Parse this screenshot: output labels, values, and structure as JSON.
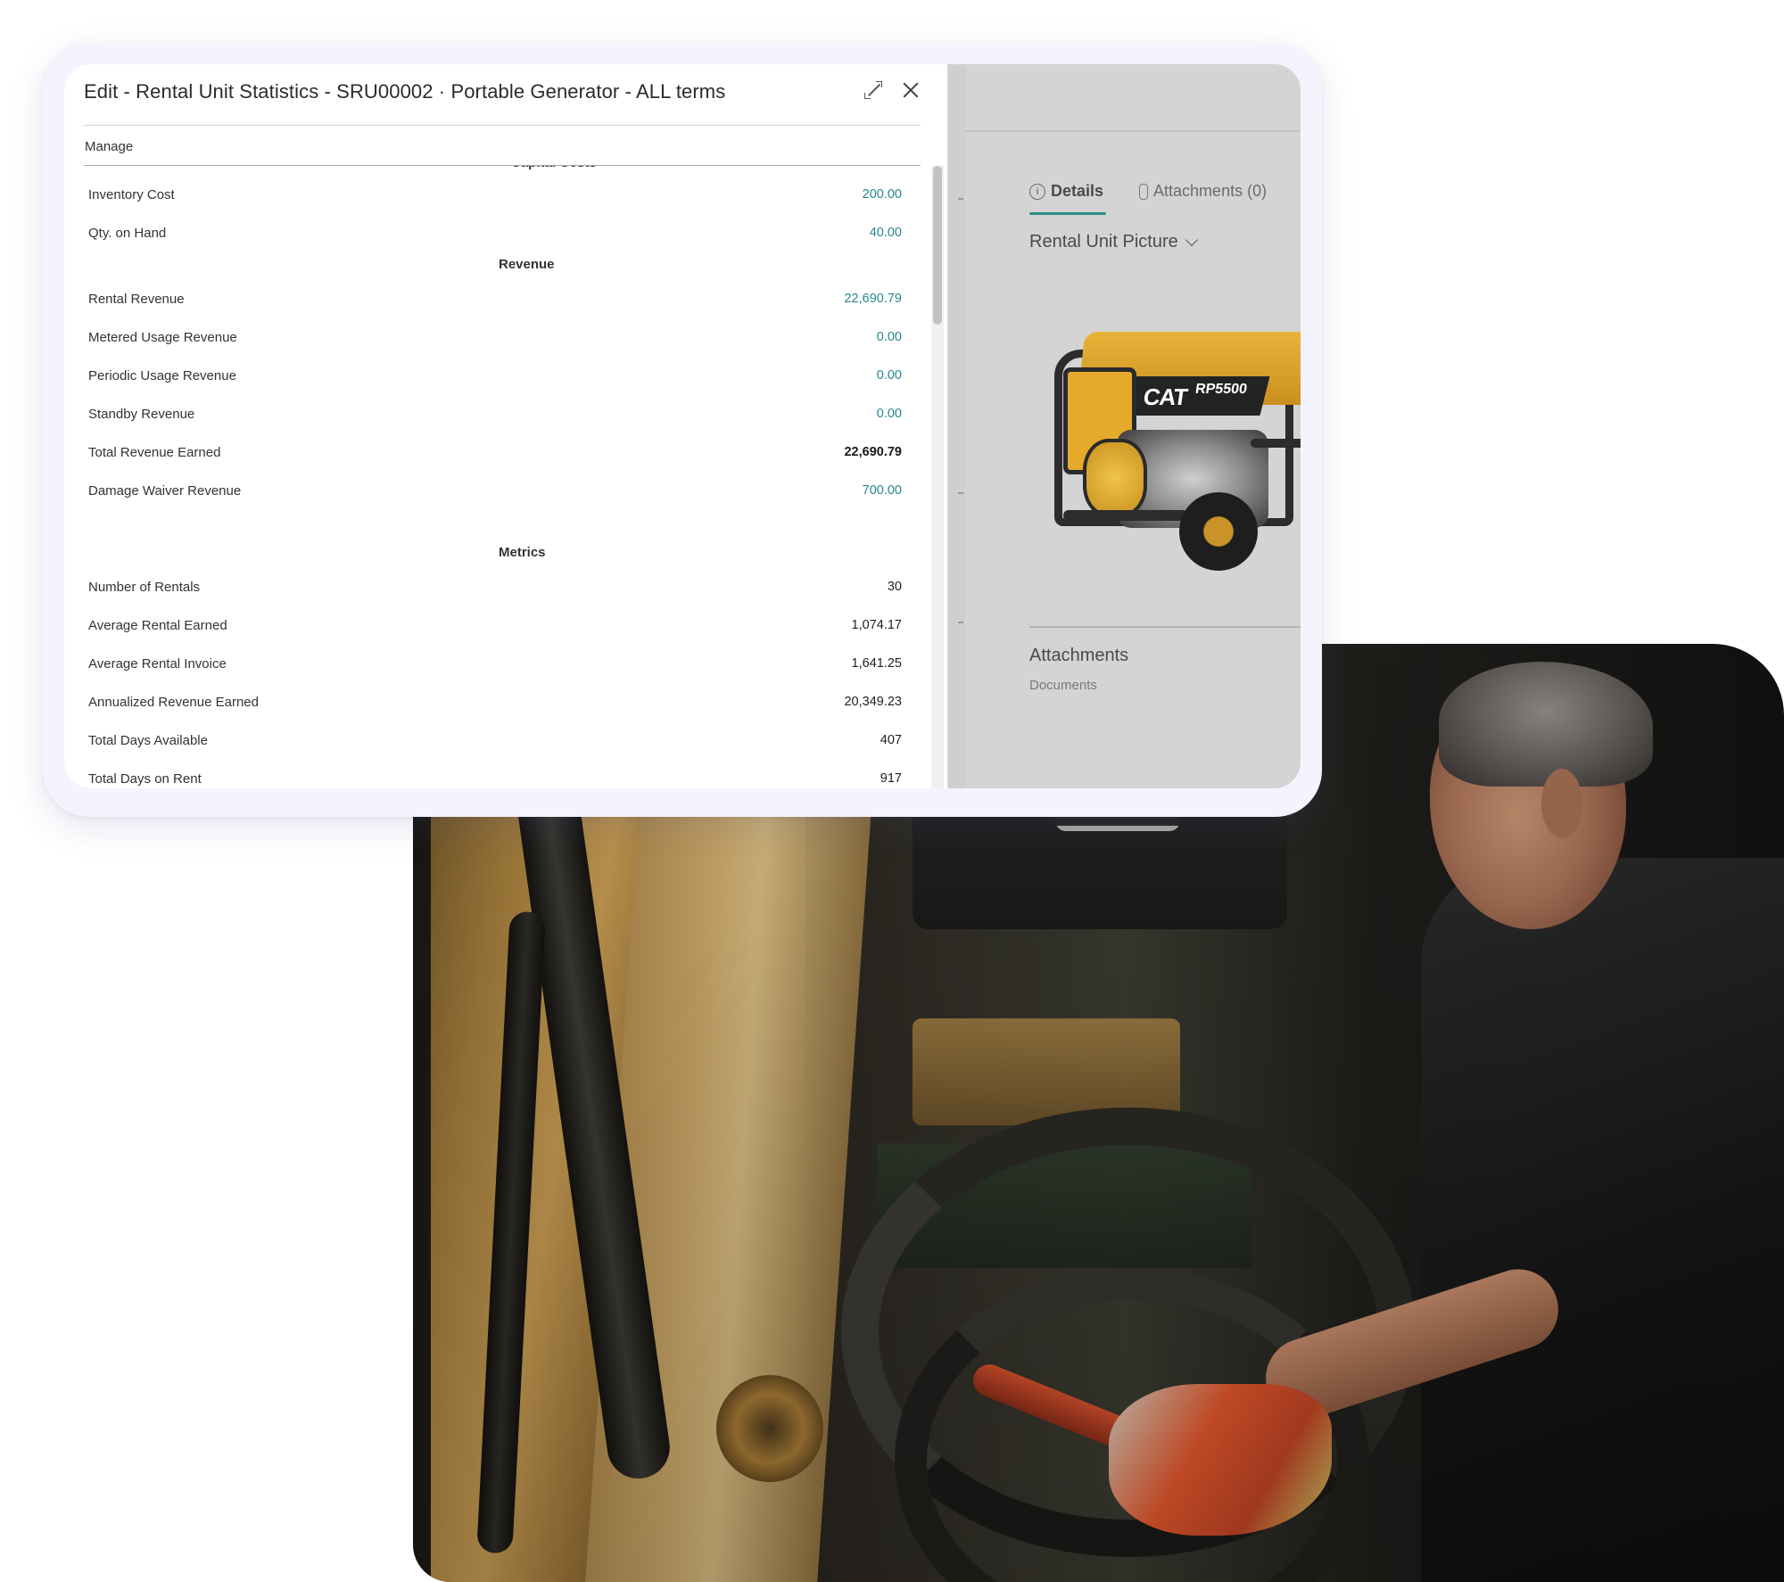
{
  "dialog": {
    "title": "Edit - Rental Unit Statistics - SRU00002 · Portable Generator - ALL terms",
    "menu_manage": "Manage",
    "rows_top": [
      {
        "label": "Inventory Cost",
        "value": "200.00",
        "style": "link"
      },
      {
        "label": "Qty. on Hand",
        "value": "40.00",
        "style": "link"
      }
    ],
    "revenue_header": "Revenue",
    "revenue_rows": [
      {
        "label": "Rental Revenue",
        "value": "22,690.79",
        "style": "link"
      },
      {
        "label": "Metered Usage Revenue",
        "value": "0.00",
        "style": "link"
      },
      {
        "label": "Periodic Usage Revenue",
        "value": "0.00",
        "style": "link"
      },
      {
        "label": "Standby Revenue",
        "value": "0.00",
        "style": "link"
      },
      {
        "label": "Total Revenue Earned",
        "value": "22,690.79",
        "style": "bold"
      },
      {
        "label": "Damage Waiver Revenue",
        "value": "700.00",
        "style": "link"
      }
    ],
    "metrics_header": "Metrics",
    "metrics_rows": [
      {
        "label": "Number of Rentals",
        "value": "30",
        "style": "plain"
      },
      {
        "label": "Average Rental Earned",
        "value": "1,074.17",
        "style": "plain"
      },
      {
        "label": "Average Rental Invoice",
        "value": "1,641.25",
        "style": "plain"
      },
      {
        "label": "Annualized Revenue Earned",
        "value": "20,349.23",
        "style": "plain"
      },
      {
        "label": "Total Days Available",
        "value": "407",
        "style": "plain"
      },
      {
        "label": "Total Days on Rent",
        "value": "917",
        "style": "plain"
      }
    ]
  },
  "sidepane": {
    "tab_details": "Details",
    "tab_attachments": "Attachments (0)",
    "picture_header": "Rental Unit Picture",
    "generator_brand": "CAT",
    "generator_model": "RP5500",
    "attachments_title": "Attachments",
    "attachments_sub": "Documents"
  },
  "colors": {
    "link": "#25868f",
    "accent_tab": "#2f8f8a"
  }
}
